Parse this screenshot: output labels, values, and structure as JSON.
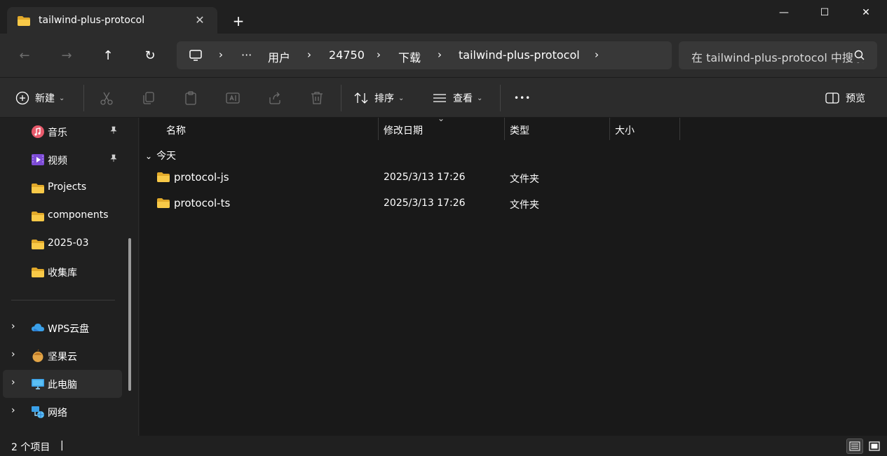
{
  "tab": {
    "title": "tailwind-plus-protocol",
    "close_glyph": "✕",
    "new_tab_glyph": "+"
  },
  "window_controls": {
    "minimize": "—",
    "maximize": "☐",
    "close": "✕"
  },
  "nav": {
    "back": "←",
    "forward": "→",
    "up": "↑",
    "refresh": "↻"
  },
  "breadcrumb": {
    "sep": "›",
    "more": "···",
    "items": [
      "用户",
      "24750",
      "下载",
      "tailwind-plus-protocol"
    ]
  },
  "search": {
    "placeholder": "在 tailwind-plus-protocol 中搜索"
  },
  "toolbar": {
    "new_label": "新建",
    "sort_label": "排序",
    "view_label": "查看",
    "more_glyph": "•••",
    "preview_label": "预览",
    "caret": "⌄"
  },
  "sidebar": {
    "pinned": [
      {
        "label": "音乐",
        "icon": "music-icon",
        "pinned": true
      },
      {
        "label": "视频",
        "icon": "video-icon",
        "pinned": true
      },
      {
        "label": "Projects",
        "icon": "folder-icon"
      },
      {
        "label": "components",
        "icon": "folder-icon"
      },
      {
        "label": "2025-03",
        "icon": "folder-icon"
      },
      {
        "label": "收集库",
        "icon": "folder-icon"
      }
    ],
    "roots": [
      {
        "label": "WPS云盘",
        "icon": "cloud-icon"
      },
      {
        "label": "坚果云",
        "icon": "nut-icon"
      },
      {
        "label": "此电脑",
        "icon": "computer-icon",
        "selected": true
      },
      {
        "label": "网络",
        "icon": "network-icon"
      }
    ],
    "pin_glyph": "📌",
    "chevron": "›"
  },
  "columns": {
    "name": "名称",
    "modified": "修改日期",
    "type": "类型",
    "size": "大小",
    "sort_indicator": "⌄"
  },
  "group": {
    "label": "今天",
    "chevron": "⌄"
  },
  "files": [
    {
      "name": "protocol-js",
      "modified": "2025/3/13 17:26",
      "type": "文件夹"
    },
    {
      "name": "protocol-ts",
      "modified": "2025/3/13 17:26",
      "type": "文件夹"
    }
  ],
  "status": {
    "count": "2 个项目",
    "bar": "|"
  },
  "colors": {
    "folder": "#f8c948",
    "folder_dark": "#e1a92a",
    "accent": "#3aa0e8"
  }
}
